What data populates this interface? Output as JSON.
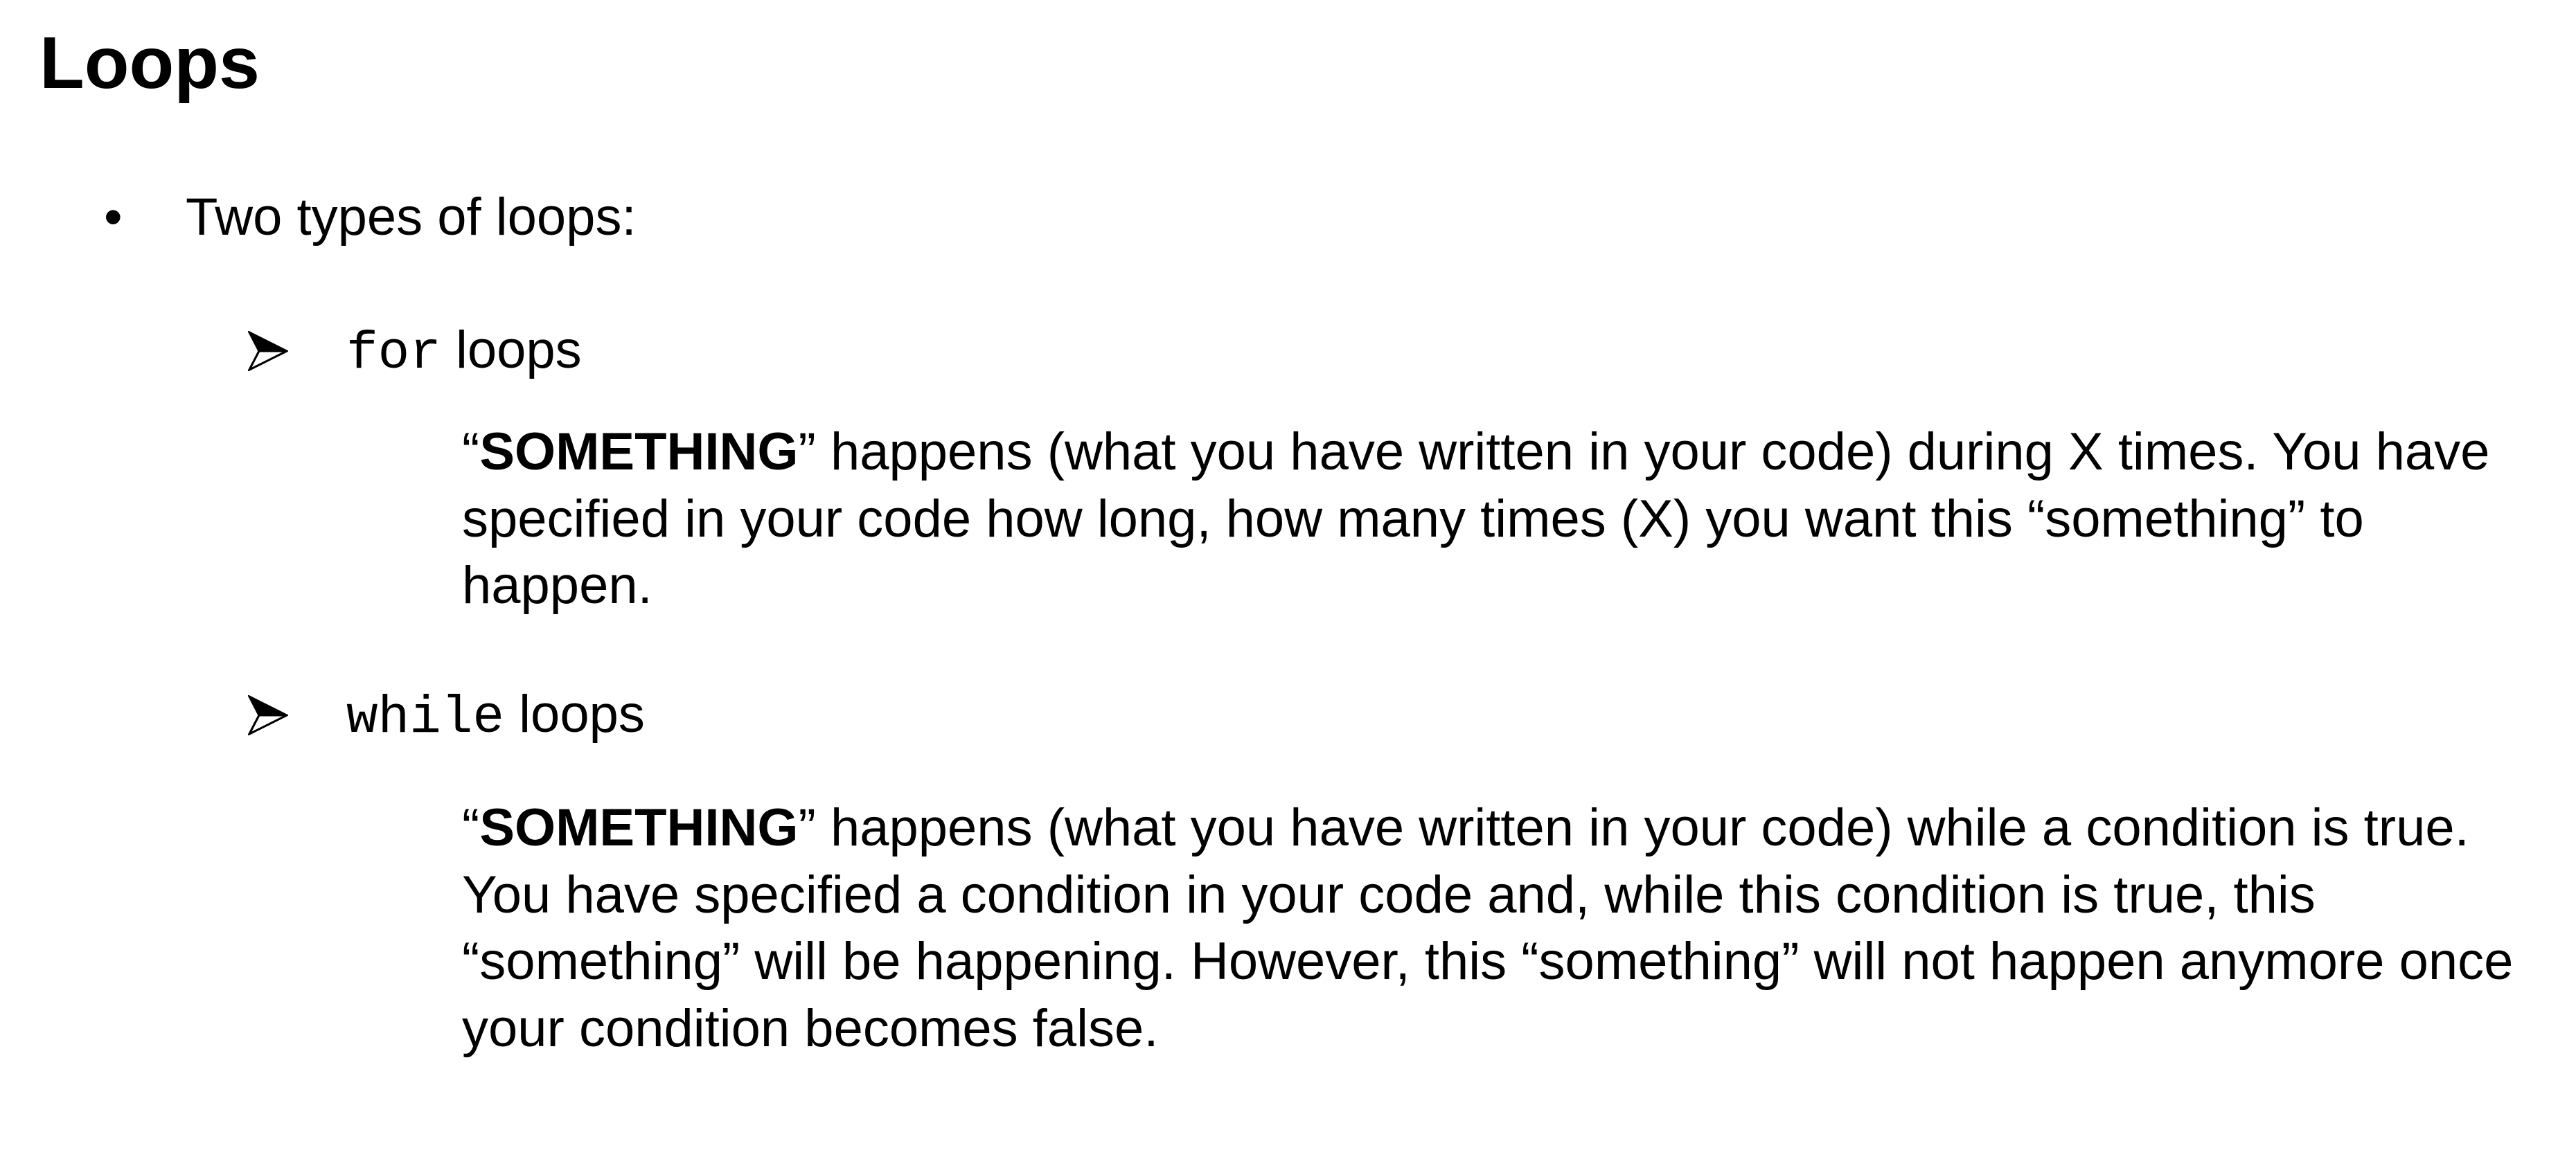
{
  "slide": {
    "title": "Loops",
    "bullet": {
      "symbol": "•",
      "text": "Two types of loops:"
    },
    "items": [
      {
        "keyword": "for",
        "label_suffix": " loops",
        "description": {
          "open_quote": "“",
          "bold_word": "SOMETHING",
          "line1_rest": "” happens (what you have written in your code) during X times. You have",
          "line2": "specified in your code how long, how many times (X) you want this “something” to",
          "line3": "happen."
        }
      },
      {
        "keyword": "while",
        "label_suffix": " loops",
        "description": {
          "open_quote": "“",
          "bold_word": "SOMETHING",
          "line1_rest": "” happens (what you have written in your code) while a condition is true.",
          "line2": "You have specified a condition in your code and, while this condition is true, this",
          "line3": "“something” will be happening. However, this “something” will not happen anymore once",
          "line4": "your condition becomes false."
        }
      }
    ]
  }
}
